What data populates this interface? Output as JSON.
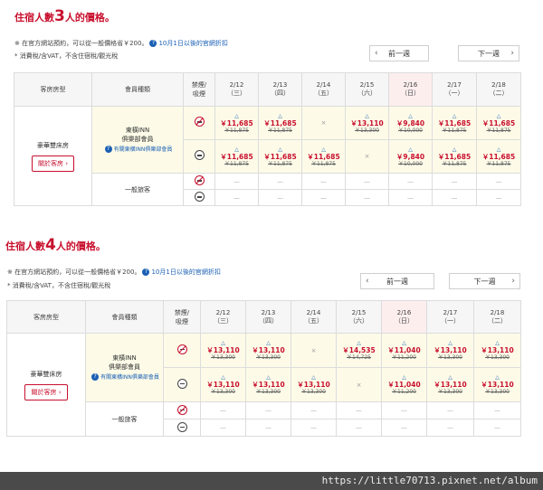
{
  "sections": [
    {
      "heading_prefix": "住宿人數",
      "heading_num": "3",
      "heading_suffix": "人的價格。",
      "note1_text": "※ 在官方網站預約，可以從一般價格省￥200。",
      "note1_link": "10月1日以後的官網折扣",
      "note2_text": "* 消費稅/含VAT，不含住宿稅/觀光稅",
      "prev_label": "前一週",
      "next_label": "下一週",
      "col_room": "客房房型",
      "col_member": "會員種類",
      "col_smoke": "禁煙/\n吸煙",
      "dates": [
        {
          "date": "2/12",
          "dow": "（三）"
        },
        {
          "date": "2/13",
          "dow": "（四）"
        },
        {
          "date": "2/14",
          "dow": "（五）"
        },
        {
          "date": "2/15",
          "dow": "（六）"
        },
        {
          "date": "2/16",
          "dow": "（日）"
        },
        {
          "date": "2/17",
          "dow": "（一）"
        },
        {
          "date": "2/18",
          "dow": "（二）"
        }
      ],
      "room_name": "豪華雙床房",
      "room_btn": "關於客房",
      "member_name": "東橫INN\n俱樂部會員",
      "member_link": "有關東橫INN俱樂部會員",
      "general_name": "一般旅客",
      "nonsmoking": [
        {
          "tri": "△",
          "price": "￥11,685",
          "old": "￥11,875"
        },
        {
          "tri": "△",
          "price": "￥11,685",
          "old": "￥11,875"
        },
        {
          "na": "×"
        },
        {
          "tri": "△",
          "price": "￥13,110",
          "old": "￥13,300"
        },
        {
          "tri": "△",
          "price": "￥9,840",
          "old": "￥10,000"
        },
        {
          "tri": "△",
          "price": "￥11,685",
          "old": "￥11,875"
        },
        {
          "tri": "△",
          "price": "￥11,685",
          "old": "￥11,875"
        }
      ],
      "smoking": [
        {
          "tri": "△",
          "price": "￥11,685",
          "old": "￥11,875"
        },
        {
          "tri": "△",
          "price": "￥11,685",
          "old": "￥11,875"
        },
        {
          "tri": "△",
          "price": "￥11,685",
          "old": "￥11,875"
        },
        {
          "na": "×"
        },
        {
          "tri": "△",
          "price": "￥9,840",
          "old": "￥10,000"
        },
        {
          "tri": "△",
          "price": "￥11,685",
          "old": "￥11,875"
        },
        {
          "tri": "△",
          "price": "￥11,685",
          "old": "￥11,875"
        }
      ],
      "general_dash": "—"
    },
    {
      "heading_prefix": "住宿人數",
      "heading_num": "4",
      "heading_suffix": "人的價格。",
      "note1_text": "※ 在官方網站預約，可以從一般價格省￥200。",
      "note1_link": "10月1日以後的官網折扣",
      "note2_text": "* 消費稅/含VAT，不含住宿稅/觀光稅",
      "prev_label": "前一週",
      "next_label": "下一週",
      "col_room": "客房房型",
      "col_member": "會員種類",
      "col_smoke": "禁煙/\n吸煙",
      "dates": [
        {
          "date": "2/12",
          "dow": "（三）"
        },
        {
          "date": "2/13",
          "dow": "（四）"
        },
        {
          "date": "2/14",
          "dow": "（五）"
        },
        {
          "date": "2/15",
          "dow": "（六）"
        },
        {
          "date": "2/16",
          "dow": "（日）"
        },
        {
          "date": "2/17",
          "dow": "（一）"
        },
        {
          "date": "2/18",
          "dow": "（二）"
        }
      ],
      "room_name": "豪華雙床房",
      "room_btn": "關於客房",
      "member_name": "東橫INN\n俱樂部會員",
      "member_link": "有關東橫INN俱樂部會員",
      "general_name": "一般旅客",
      "nonsmoking": [
        {
          "tri": "△",
          "price": "￥13,110",
          "old": "￥13,300"
        },
        {
          "tri": "△",
          "price": "￥13,110",
          "old": "￥13,300"
        },
        {
          "na": "×"
        },
        {
          "tri": "△",
          "price": "￥14,535",
          "old": "￥14,725"
        },
        {
          "tri": "△",
          "price": "￥11,040",
          "old": "￥11,200"
        },
        {
          "tri": "△",
          "price": "￥13,110",
          "old": "￥13,300"
        },
        {
          "tri": "△",
          "price": "￥13,110",
          "old": "￥13,300"
        }
      ],
      "smoking": [
        {
          "tri": "△",
          "price": "￥13,110",
          "old": "￥13,300"
        },
        {
          "tri": "△",
          "price": "￥13,110",
          "old": "￥13,300"
        },
        {
          "tri": "△",
          "price": "￥13,110",
          "old": "￥13,300"
        },
        {
          "na": "×"
        },
        {
          "tri": "△",
          "price": "￥11,040",
          "old": "￥11,200"
        },
        {
          "tri": "△",
          "price": "￥13,110",
          "old": "￥13,300"
        },
        {
          "tri": "△",
          "price": "￥13,110",
          "old": "￥13,300"
        }
      ],
      "general_dash": "—"
    }
  ],
  "footer": {
    "url": "https://little70713.pixnet.net/album"
  },
  "colors": {
    "accent": "#c8102e",
    "link": "#1a5fb4",
    "price_bg": "#fdfbe8",
    "footer_bg": "#4a4a4a"
  },
  "icons": {
    "nonsmoking": "no-smoking-icon",
    "smoking": "smoking-icon",
    "help": "question-icon"
  }
}
